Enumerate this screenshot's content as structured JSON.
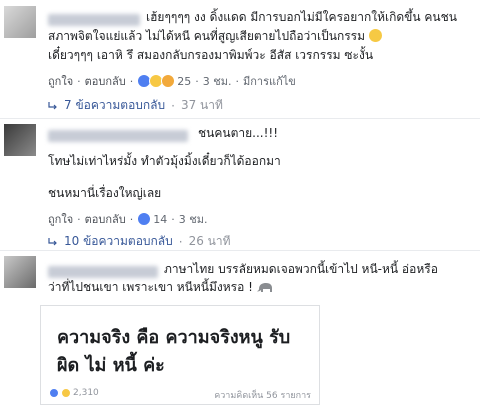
{
  "comments": [
    {
      "lines": [
        "เฮ้ยๆๆๆๆ งง ดิ้งแดด มีการบอกไม่มีใครอยากให้เกิดขึ้น คนชน",
        "สภาพจิตใจแย่แล้ว ไม่ได้หนี คนที่สูญเสียตายไปถือว่าเป็นกรรม",
        "เดี๋ยวๆๆๆ เอาหิ รึ สมองกลับกรองมาพิมพ์วะ อีสัส เวรกรรม ซะงั้น"
      ],
      "like": "ถูกใจ",
      "reply": "ตอบกลับ",
      "count": "25",
      "age": "3 ชม.",
      "edited": "มีการแก้ไข",
      "replies": "7 ข้อความตอบกลับ",
      "replies_age": "37 นาที"
    },
    {
      "lines": [
        "ชนคนตาย...!!!",
        "โทษไม่เท่าไหร่มั้ง ทำตัวมุ้งมิ้งเดี๋ยวก็ได้ออกมา",
        "ชนหมานี่เรื่องใหญ่เลย"
      ],
      "like": "ถูกใจ",
      "reply": "ตอบกลับ",
      "count": "14",
      "age": "3 ชม.",
      "replies": "10 ข้อความตอบกลับ",
      "replies_age": "26 นาที"
    },
    {
      "lines": [
        "ภาษาไทย บรรลัยหมดเจอพวกนี้เข้าไป หนี-หนี้ อ่อหรือ",
        "ว่าที่ไปชนเขา เพราะเขา หนีหนี้มึงหรอ !"
      ],
      "quote": {
        "title": "ความจริง คือ ความจริงหนู รับ ผิด ไม่ หนี้ ค่ะ",
        "reactions": "2,310",
        "comments": "ความคิดเห็น 56 รายการ"
      }
    }
  ],
  "icons": {
    "arrow": "reply-arrow-icon",
    "reactions": [
      "like-icon",
      "wow-icon",
      "sad-icon"
    ]
  },
  "colors": {
    "link": "#385898",
    "meta": "#616770",
    "like": "#4f7ff1"
  }
}
